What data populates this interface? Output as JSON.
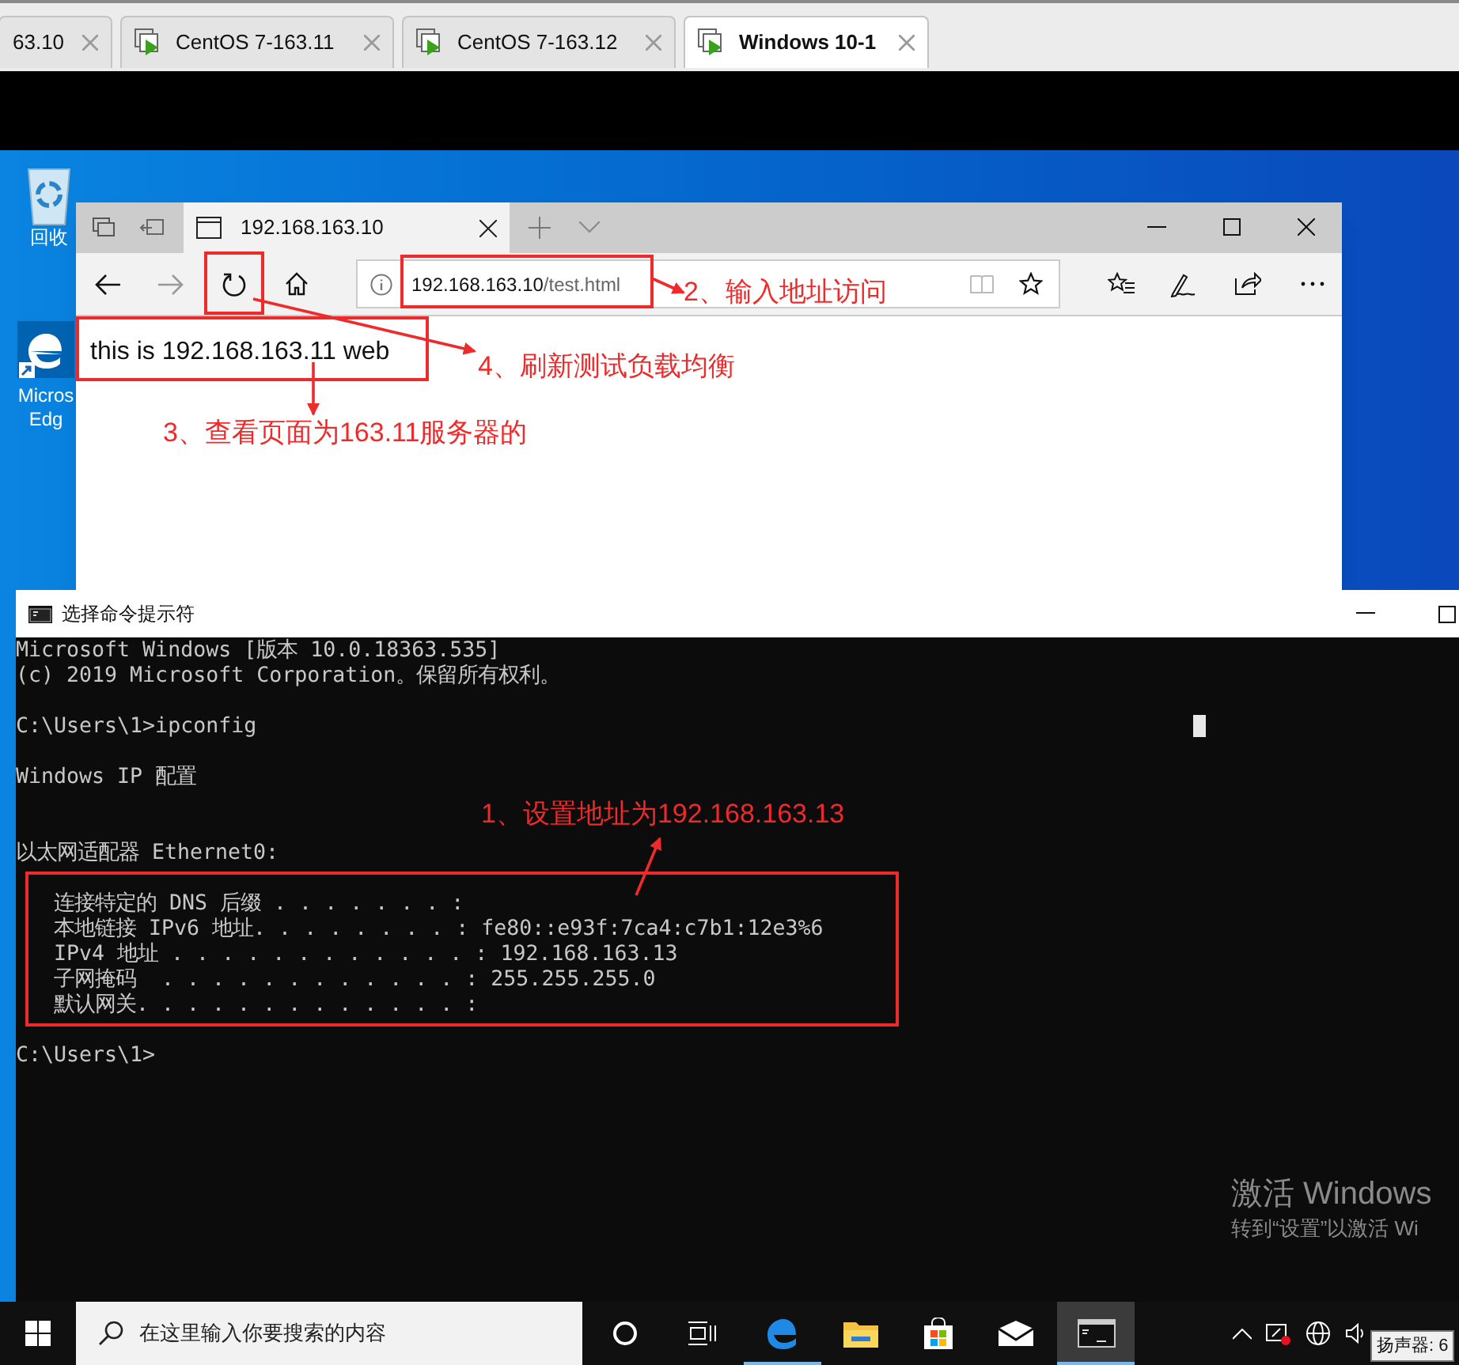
{
  "vm_tabs": [
    {
      "label": "63.10",
      "selected": false
    },
    {
      "label": "CentOS 7-163.11",
      "selected": false
    },
    {
      "label": "CentOS 7-163.12",
      "selected": false
    },
    {
      "label": "Windows 10-1",
      "selected": true
    }
  ],
  "desktop_icons": [
    {
      "kind": "recycle_bin",
      "label_lines": [
        "回收"
      ]
    },
    {
      "kind": "edge_shortcut",
      "label_lines": [
        "Micros",
        "Edg"
      ]
    }
  ],
  "browser": {
    "tab_title": "192.168.163.10",
    "url_host": "192.168.163.10",
    "url_path": "/test.html",
    "page_text": "this is 192.168.163.11 web"
  },
  "console": {
    "title": "选择命令提示符",
    "blocks": [
      {
        "lines": [
          "Microsoft Windows [版本 10.0.18363.535]",
          "(c) 2019 Microsoft Corporation。保留所有权利。"
        ]
      },
      {
        "lines": [
          "C:\\Users\\1>ipconfig"
        ]
      },
      {
        "lines": [
          "Windows IP 配置"
        ]
      }
    ],
    "adapter": {
      "heading": "以太网适配器 Ethernet0:",
      "lines": [
        "   连接特定的 DNS 后缀 . . . . . . . :",
        "   本地链接 IPv6 地址. . . . . . . . : fe80::e93f:7ca4:c7b1:12e3%6",
        "   IPv4 地址 . . . . . . . . . . . . : 192.168.163.13",
        "   子网掩码  . . . . . . . . . . . . : 255.255.255.0",
        "   默认网关. . . . . . . . . . . . . :"
      ]
    },
    "prompt": "C:\\Users\\1>"
  },
  "annotations": [
    {
      "text": "2、输入地址访问"
    },
    {
      "text": "4、刷新测试负载均衡"
    },
    {
      "text": "3、查看页面为163.11服务器的"
    },
    {
      "text": "1、设置地址为192.168.163.13"
    }
  ],
  "activation": {
    "heading": "激活 Windows",
    "hint": "转到“设置”以激活 Wi"
  },
  "taskbar": {
    "search_placeholder": "在这里输入你要搜索的内容",
    "apps": [
      {
        "kind": "cortana",
        "running": false,
        "selected": false
      },
      {
        "kind": "task_view",
        "running": false,
        "selected": false
      },
      {
        "kind": "edge",
        "running": true,
        "selected": false
      },
      {
        "kind": "explorer",
        "running": false,
        "selected": false
      },
      {
        "kind": "store",
        "running": false,
        "selected": false
      },
      {
        "kind": "mail",
        "running": false,
        "selected": false
      },
      {
        "kind": "console",
        "running": true,
        "selected": true
      }
    ],
    "tooltip": "扬声器: 6"
  }
}
